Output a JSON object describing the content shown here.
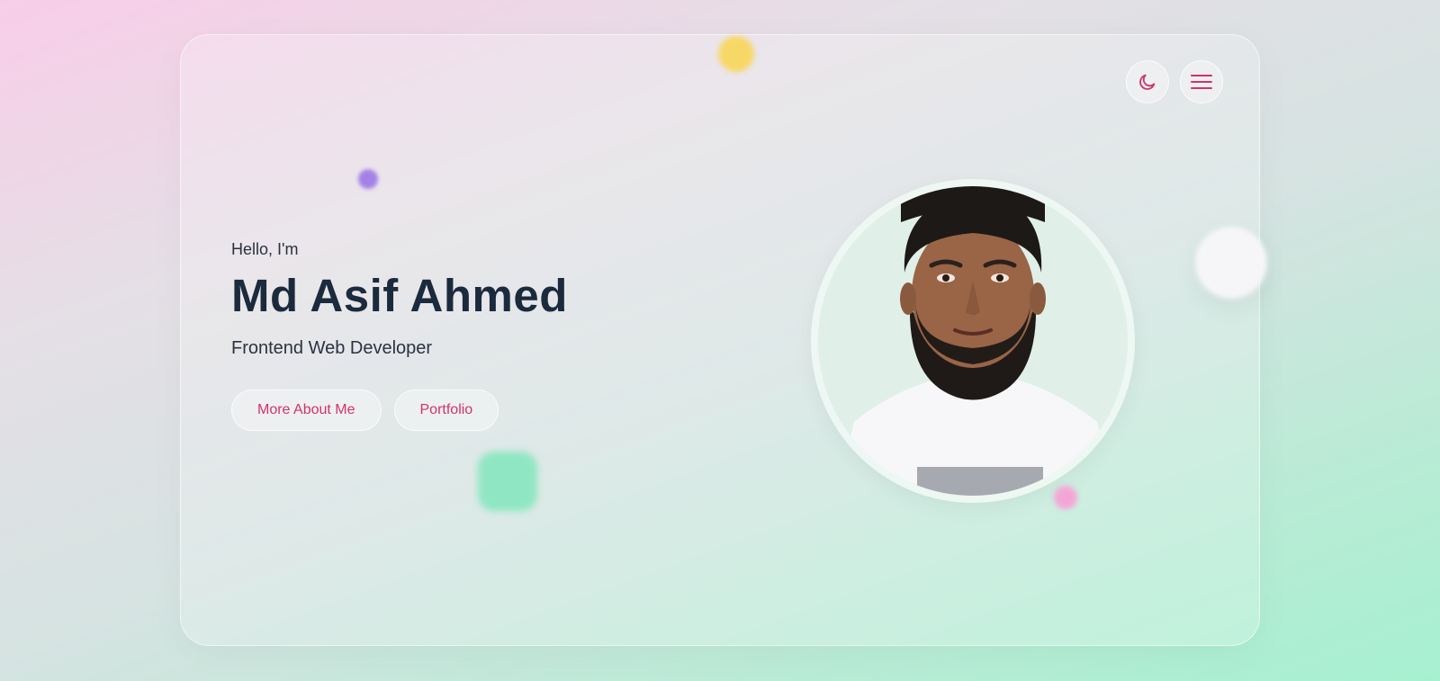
{
  "hero": {
    "greeting": "Hello, I'm",
    "name": "Md Asif Ahmed",
    "role": "Frontend Web Developer"
  },
  "buttons": {
    "about_label": "More About Me",
    "portfolio_label": "Portfolio"
  },
  "controls": {
    "theme_icon": "moon-icon",
    "menu_icon": "hamburger-menu-icon"
  },
  "colors": {
    "accent": "#d1336a",
    "heading": "#1c2a3d",
    "text": "#2b3240"
  }
}
